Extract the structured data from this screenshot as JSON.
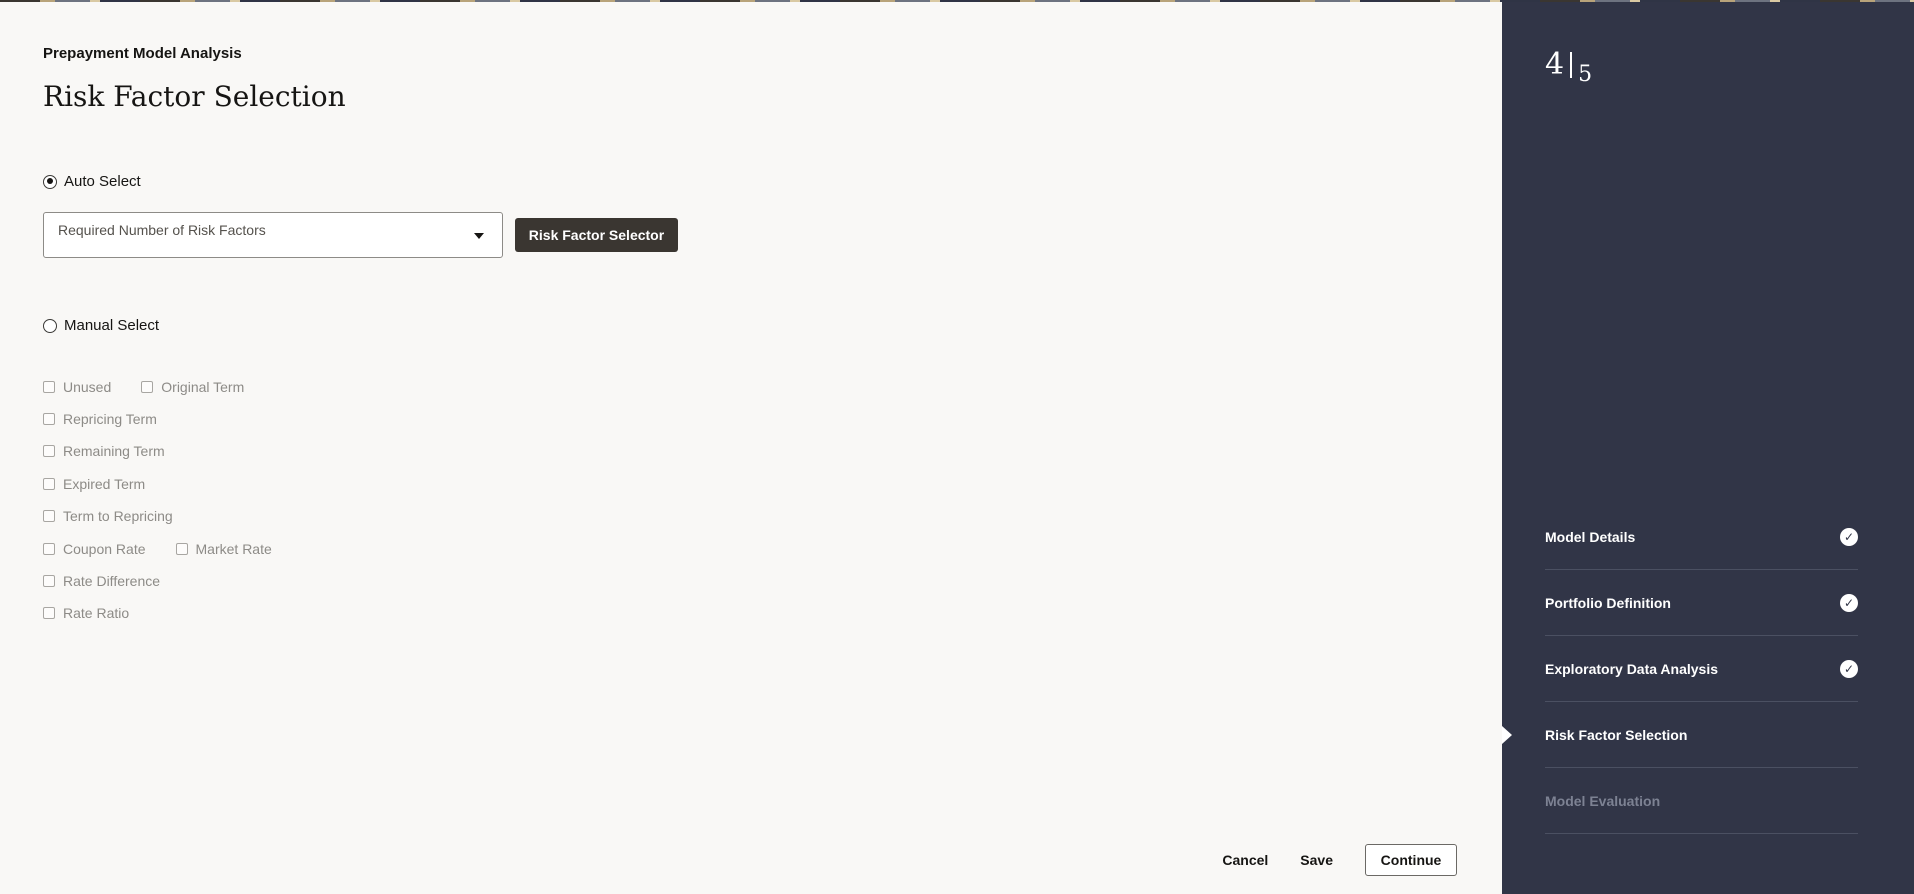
{
  "header": {
    "breadcrumb": "Prepayment Model Analysis",
    "title": "Risk Factor Selection"
  },
  "auto_select": {
    "label": "Auto Select",
    "selected": true,
    "dropdown_label": "Required Number of Risk Factors",
    "button_label": "Risk Factor Selector"
  },
  "manual_select": {
    "label": "Manual Select",
    "selected": false,
    "rows": [
      [
        "Unused",
        "Original Term"
      ],
      [
        "Repricing Term"
      ],
      [
        "Remaining Term"
      ],
      [
        "Expired Term"
      ],
      [
        "Term to Repricing"
      ],
      [
        "Coupon Rate",
        "Market Rate"
      ],
      [
        "Rate Difference"
      ],
      [
        "Rate Ratio"
      ]
    ]
  },
  "footer": {
    "cancel": "Cancel",
    "save": "Save",
    "continue": "Continue"
  },
  "progress": {
    "current": "4",
    "total": "5",
    "steps": [
      {
        "label": "Model Details",
        "status": "done"
      },
      {
        "label": "Portfolio Definition",
        "status": "done"
      },
      {
        "label": "Exploratory Data Analysis",
        "status": "done"
      },
      {
        "label": "Risk Factor Selection",
        "status": "current"
      },
      {
        "label": "Model Evaluation",
        "status": "disabled"
      }
    ]
  },
  "colors": {
    "sidebar_bg": "#313547",
    "primary_button_bg": "#3a3631",
    "page_bg": "#f9f8f6"
  }
}
